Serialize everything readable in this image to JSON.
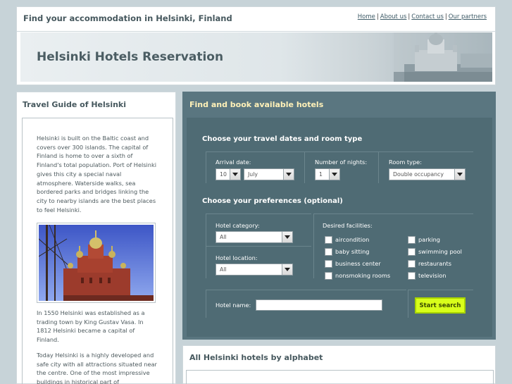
{
  "header": {
    "site_title": "Find your accommodation in Helsinki, Finland",
    "links": [
      "Home",
      "About us",
      "Contact us",
      "Our partners"
    ]
  },
  "banner": {
    "title": "Helsinki Hotels Reservation"
  },
  "left": {
    "heading": "Travel Guide of Helsinki",
    "para1": "Helsinki is built on the Baltic coast and covers over 300 islands. The capital of Finland is home to over a sixth of Finland's total population. Port of Helsinki gives this city a special naval atmosphere. Waterside walks, sea bordered parks and bridges linking the city to nearby islands are the best places to feel Helsinki.",
    "para2": "In 1550 Helsinki was established as a trading town by King Gustav Vasa. In 1812 Helsinki became a capital of Finland.",
    "para3": "Today Helsinki is a highly developed and safe city with all attractions situated near the centre. One of the most impressive buildings in historical part of"
  },
  "search": {
    "heading": "Find and book available hotels",
    "dates_title": "Choose your travel dates and room type",
    "arrival_label": "Arrival date:",
    "arrival_day": "10",
    "arrival_month": "July",
    "nights_label": "Number of nights:",
    "nights_value": "1",
    "room_label": "Room type:",
    "room_value": "Double occupancy",
    "prefs_title": "Choose your preferences (optional)",
    "category_label": "Hotel category:",
    "category_value": "All",
    "location_label": "Hotel location:",
    "location_value": "All",
    "facilities_label": "Desired facilities:",
    "facilities": [
      "aircondition",
      "parking",
      "baby sitting",
      "swimming pool",
      "business center",
      "restaurants",
      "nonsmoking rooms",
      "television"
    ],
    "hotel_name_label": "Hotel name:",
    "hotel_name_value": "",
    "search_button": "Start search"
  },
  "bottom": {
    "heading": "All Helsinki hotels by alphabet"
  },
  "colors": {
    "panel": "#5a7680",
    "accent_button": "#d8ff1a",
    "heading_yellow": "#fff1b8"
  }
}
